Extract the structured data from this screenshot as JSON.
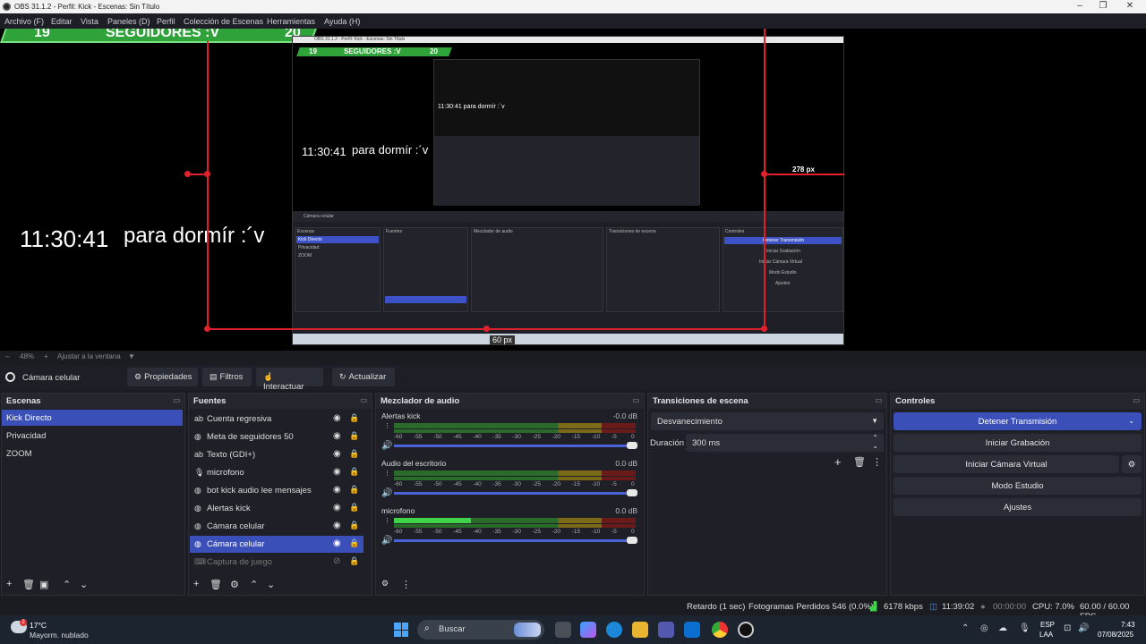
{
  "window": {
    "title": "OBS 31.1.2 - Perfil: Kick - Escenas: Sin Título"
  },
  "menu": [
    "Archivo (F)",
    "Editar",
    "Vista",
    "Paneles (D)",
    "Perfil",
    "Colección de Escenas",
    "Herramientas",
    "Ayuda (H)"
  ],
  "preview": {
    "follow_current": "19",
    "follow_label": "SEGUIDORES :V",
    "follow_goal": "20",
    "clock": "11:30:41",
    "sleep_text": "para dormír :´v",
    "px_label": "278 px",
    "px_small": "60 px",
    "nested_title": "OBS 31.1.2 - Perfil: Kick - Escenas: Sin Título",
    "nested_clock": "11:30:41",
    "nested_sleep": "para dormír :´v",
    "deep_text": "11:30:41  para dormír :´v",
    "mini_scene": "Cámara celular",
    "mini_docks": [
      "Escenas",
      "Fuentes",
      "Mezclador de audio",
      "Transiciones de escena",
      "Controles"
    ],
    "mini_scenes": [
      "Kick Directo",
      "Privacidad",
      "ZOOM"
    ],
    "mini_controls": [
      "Detener Transmisión",
      "Iniciar Grabación",
      "Iniciar Cámara Virtual",
      "Modo Estudio",
      "Ajustes"
    ]
  },
  "zoom": {
    "level": "48%",
    "fit_label": "Ajustar a la ventana"
  },
  "source_bar": {
    "name": "Cámara celular",
    "properties": "Propiedades",
    "filters": "Filtros",
    "interact": "Interactuar",
    "refresh": "Actualizar"
  },
  "scenes": {
    "title": "Escenas",
    "items": [
      {
        "label": "Kick Directo",
        "active": true
      },
      {
        "label": "Privacidad",
        "active": false
      },
      {
        "label": "ZOOM",
        "active": false
      }
    ]
  },
  "sources": {
    "title": "Fuentes",
    "items": [
      {
        "label": "Cuenta regresiva",
        "icon": "text-icon"
      },
      {
        "label": "Meta de seguidores 50",
        "icon": "globe-icon"
      },
      {
        "label": "Texto (GDI+)",
        "icon": "text-icon"
      },
      {
        "label": "microfono",
        "icon": "mic-icon"
      },
      {
        "label": "bot kick audio lee mensajes",
        "icon": "globe-icon"
      },
      {
        "label": "Alertas kick",
        "icon": "globe-icon"
      },
      {
        "label": "Cámara celular",
        "icon": "globe-icon"
      },
      {
        "label": "Cámara celular",
        "icon": "globe-icon",
        "active": true
      },
      {
        "label": "Captura de juego",
        "icon": "gamepad-icon",
        "hidden": true
      }
    ]
  },
  "mixer": {
    "title": "Mezclador de audio",
    "scale": [
      "-60",
      "-55",
      "-50",
      "-45",
      "-40",
      "-35",
      "-30",
      "-25",
      "-20",
      "-15",
      "-10",
      "-5",
      "0"
    ],
    "channels": [
      {
        "name": "Alertas kick",
        "db": "-0.0 dB",
        "level": 0
      },
      {
        "name": "Audio del escritorio",
        "db": "0.0 dB",
        "level": 0
      },
      {
        "name": "microfono",
        "db": "0.0 dB",
        "level": 0.32
      }
    ]
  },
  "transitions": {
    "title": "Transiciones de escena",
    "selected": "Desvanecimiento",
    "duration_label": "Duración",
    "duration_value": "300 ms"
  },
  "controls": {
    "title": "Controles",
    "stop_stream": "Detener Transmisión",
    "start_recording": "Iniciar Grabación",
    "start_virtual_cam": "Iniciar Cámara Virtual",
    "studio_mode": "Modo Estudio",
    "settings": "Ajustes"
  },
  "status": {
    "delay": "Retardo (1 sec)",
    "dropped": "Fotogramas Perdidos 546 (0.0%)",
    "bitrate": "6178 kbps",
    "stream_time": "11:39:02",
    "rec_time": "00:00:00",
    "cpu": "CPU: 7.0%",
    "fps": "60.00 / 60.00 FPS"
  },
  "taskbar": {
    "weather_badge": "2",
    "temp": "17°C",
    "weather": "Mayorm. nublado",
    "search_placeholder": "Buscar",
    "lang1": "ESP",
    "lang2": "LAA",
    "time": "7:43",
    "date": "07/08/2025"
  }
}
